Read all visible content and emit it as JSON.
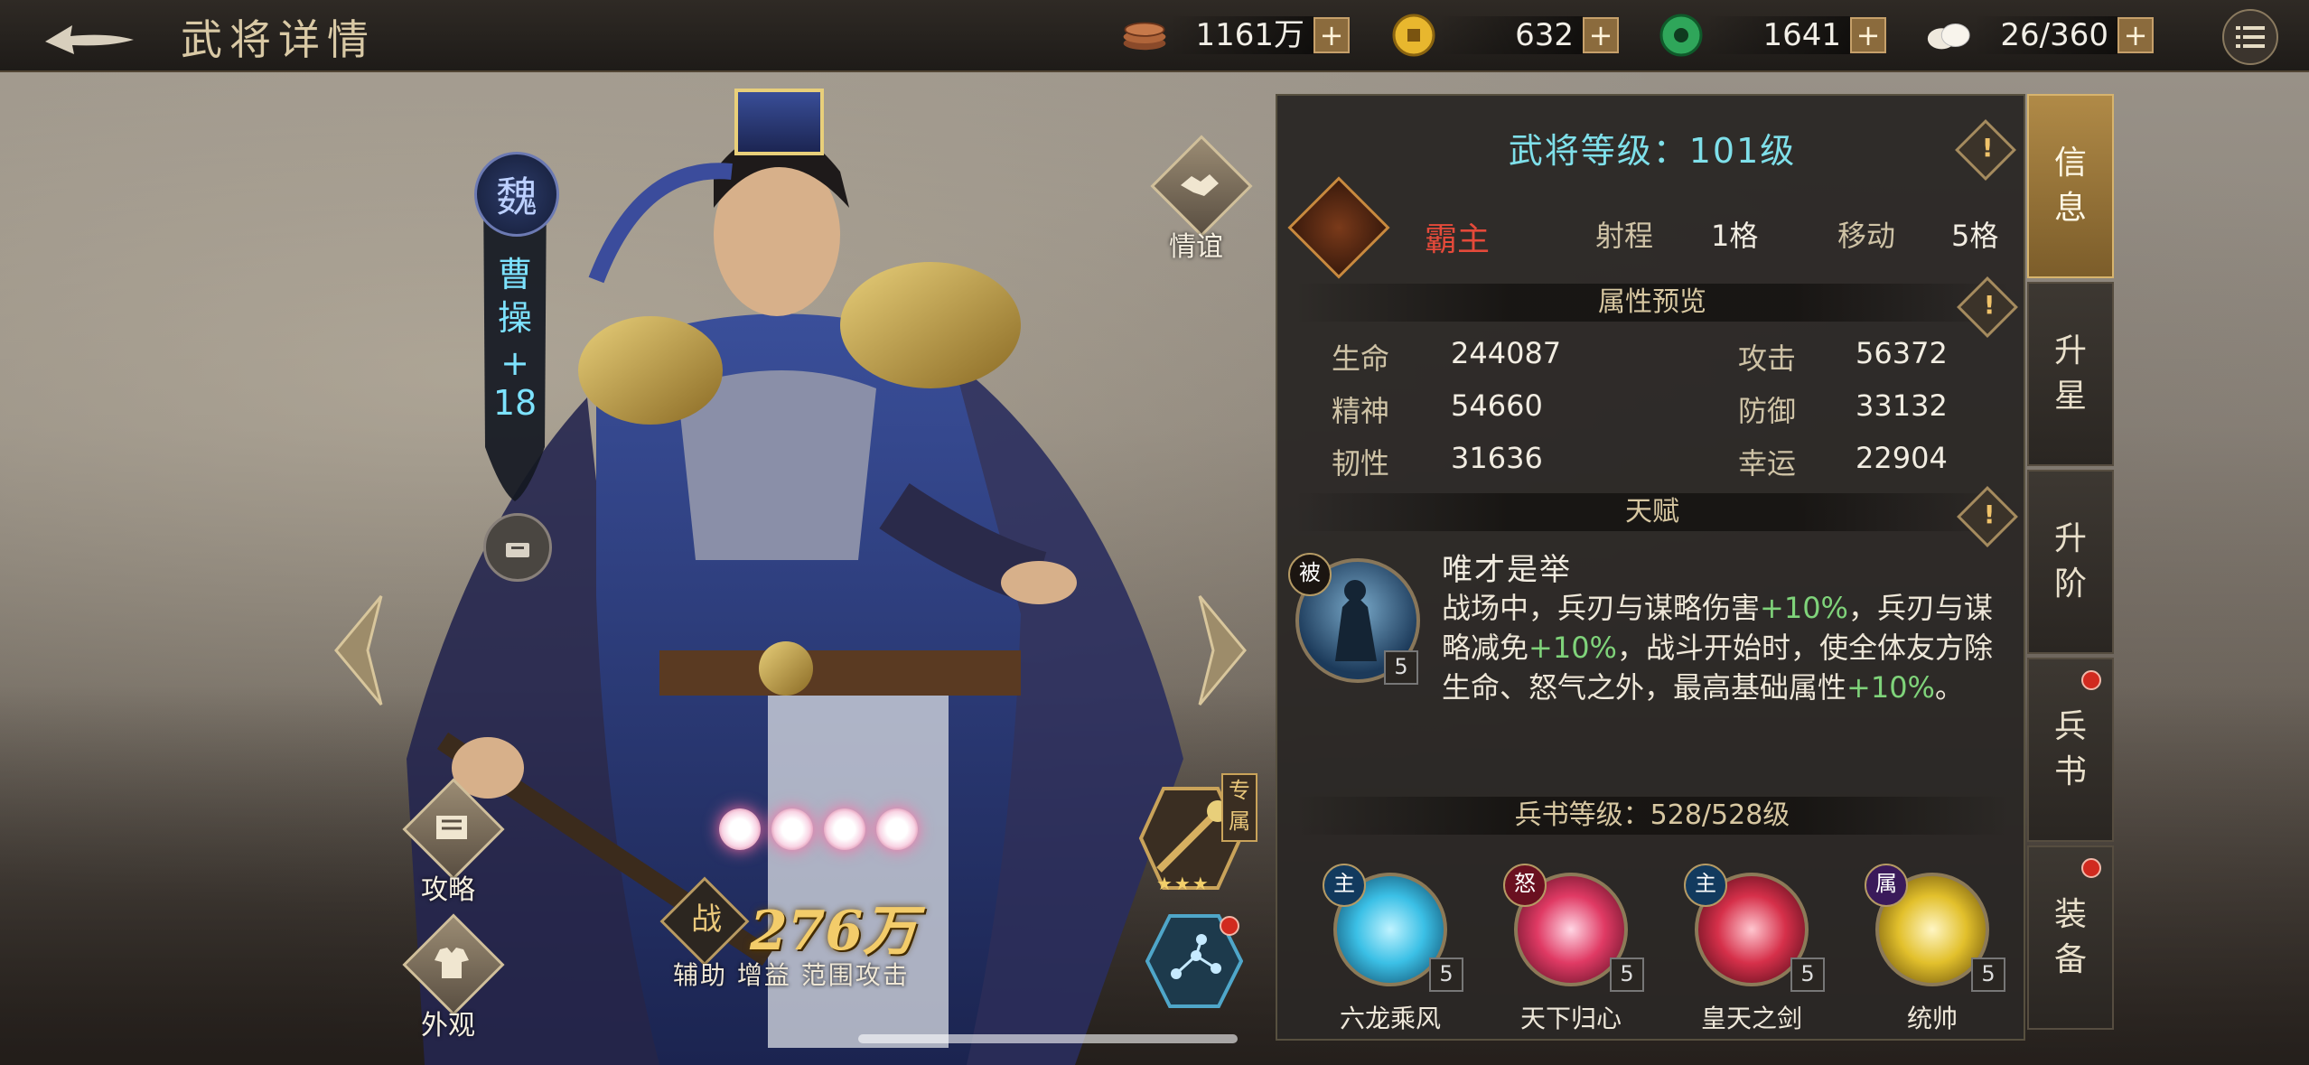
{
  "header": {
    "title": "武将详情",
    "resources": [
      {
        "name": "copper",
        "icon": "copper-coins-icon",
        "value": "1161万"
      },
      {
        "name": "gold",
        "icon": "gold-coin-icon",
        "value": "632"
      },
      {
        "name": "jade",
        "icon": "jade-coin-icon",
        "value": "1641"
      },
      {
        "name": "food",
        "icon": "buns-icon",
        "value": "26/360"
      }
    ],
    "plus_label": "+"
  },
  "hero": {
    "faction": "魏",
    "name": "曹操",
    "level_bonus": "+\n18",
    "friendship_label": "情谊",
    "strategy_label": "攻略",
    "appearance_label": "外观",
    "exclusive_label": "专属",
    "power_glyph": "战",
    "power": "276万",
    "roles": "辅助 增益 范围攻击",
    "orb_count": 4,
    "exclusive_stars": 3
  },
  "panel": {
    "level_title": "武将等级：101级",
    "class_name": "霸主",
    "range_label": "射程",
    "range_value": "1格",
    "move_label": "移动",
    "move_value": "5格",
    "attr_section": "属性预览",
    "attributes": [
      {
        "label": "生命",
        "value": "244087"
      },
      {
        "label": "攻击",
        "value": "56372"
      },
      {
        "label": "精神",
        "value": "54660"
      },
      {
        "label": "防御",
        "value": "33132"
      },
      {
        "label": "韧性",
        "value": "31636"
      },
      {
        "label": "幸运",
        "value": "22904"
      }
    ],
    "talent_section": "天赋",
    "talent": {
      "type_badge": "被",
      "level": "5",
      "name": "唯才是举",
      "desc_parts": [
        "战场中，兵刃与谋略伤害",
        "+10%",
        "，兵刃与谋略减免",
        "+10%",
        "，战斗开始时，使全体友方除生命、怒气之外，最高基础属性",
        "+10%",
        "。"
      ]
    },
    "book_section": "兵书等级：528/528级",
    "skills": [
      {
        "badge": "主",
        "name": "六龙乘风",
        "level": "5",
        "color": "#3bc0e6"
      },
      {
        "badge": "怒",
        "name": "天下归心",
        "level": "5",
        "color": "#e03a64"
      },
      {
        "badge": "主",
        "name": "皇天之剑",
        "level": "5",
        "color": "#d6304a"
      },
      {
        "badge": "属",
        "name": "统帅",
        "level": "5",
        "color": "#e2c02c"
      }
    ]
  },
  "tabs": [
    {
      "label": "信息",
      "active": true,
      "dot": false
    },
    {
      "label": "升星",
      "active": false,
      "dot": false
    },
    {
      "label": "升阶",
      "active": false,
      "dot": false
    },
    {
      "label": "兵书",
      "active": false,
      "dot": true
    },
    {
      "label": "装备",
      "active": false,
      "dot": true
    }
  ],
  "colors": {
    "accent": "#7fe0ea",
    "highlight": "#7fd37a",
    "class": "#e54a3a",
    "name": "#7de3ff"
  }
}
